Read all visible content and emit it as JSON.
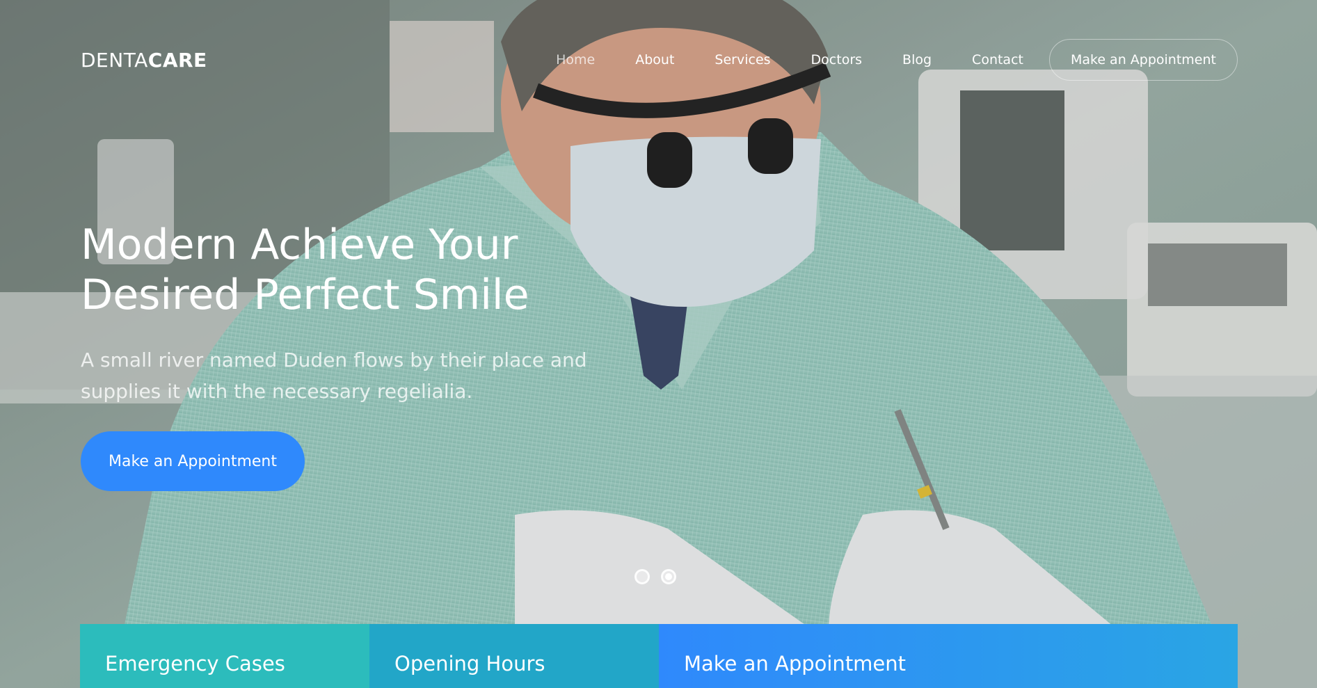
{
  "brand": {
    "logo_light": "DENTA",
    "logo_bold": "CARE"
  },
  "nav": {
    "items": [
      {
        "label": "Home",
        "active": true
      },
      {
        "label": "About"
      },
      {
        "label": "Services"
      },
      {
        "label": "Doctors"
      },
      {
        "label": "Blog"
      },
      {
        "label": "Contact"
      }
    ],
    "cta_label": "Make an Appointment"
  },
  "hero": {
    "headline_line1": "Modern Achieve Your",
    "headline_line2": "Desired Perfect Smile",
    "subtext": "A small river named Duden flows by their place and supplies it with the necessary regelialia.",
    "cta_label": "Make an Appointment",
    "slides": {
      "count": 2,
      "active_index": 2
    }
  },
  "info_strip": {
    "panels": [
      {
        "title": "Emergency Cases",
        "color": "#2cbcbc"
      },
      {
        "title": "Opening Hours",
        "color": "#22a6c8"
      },
      {
        "title": "Make an Appointment",
        "color": "#2f89fc"
      }
    ]
  },
  "colors": {
    "primary": "#2f89fc",
    "text_on_hero": "#ffffff"
  }
}
